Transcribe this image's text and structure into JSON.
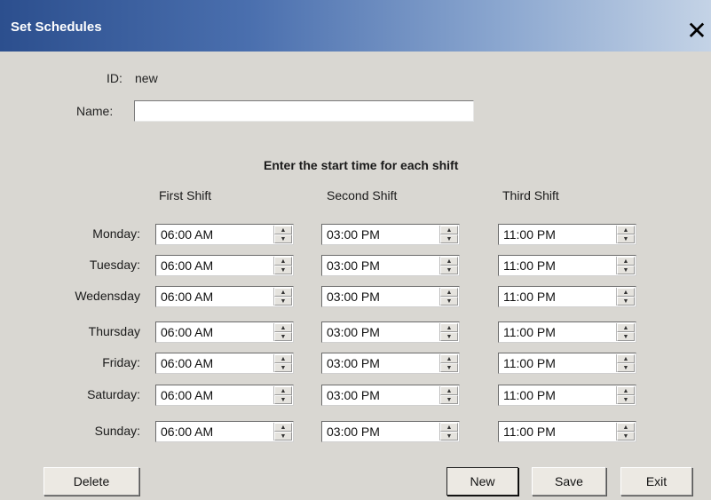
{
  "window": {
    "title": "Set Schedules",
    "close_label": "✕"
  },
  "form": {
    "id_label": "ID:",
    "id_value": "new",
    "name_label": "Name:",
    "name_value": "",
    "instruction": "Enter the start time for each shift"
  },
  "columns": [
    "First Shift",
    "Second Shift",
    "Third Shift"
  ],
  "rows": [
    {
      "day": "Monday:",
      "times": [
        "06:00 AM",
        "03:00 PM",
        "11:00 PM"
      ]
    },
    {
      "day": "Tuesday:",
      "times": [
        "06:00 AM",
        "03:00 PM",
        "11:00 PM"
      ]
    },
    {
      "day": "Wedensday",
      "times": [
        "06:00 AM",
        "03:00 PM",
        "11:00 PM"
      ]
    },
    {
      "day": "Thursday",
      "times": [
        "06:00 AM",
        "03:00 PM",
        "11:00 PM"
      ]
    },
    {
      "day": "Friday:",
      "times": [
        "06:00 AM",
        "03:00 PM",
        "11:00 PM"
      ]
    },
    {
      "day": "Saturday:",
      "times": [
        "06:00 AM",
        "03:00 PM",
        "11:00 PM"
      ]
    },
    {
      "day": "Sunday:",
      "times": [
        "06:00 AM",
        "03:00 PM",
        "11:00 PM"
      ]
    }
  ],
  "buttons": {
    "delete": "Delete",
    "new": "New",
    "save": "Save",
    "exit": "Exit"
  },
  "icons": {
    "close": "close-icon",
    "spin_up": "spin-up-icon",
    "spin_down": "spin-down-icon"
  },
  "colors": {
    "titlebar_start": "#2c4f8e",
    "titlebar_end": "#c4d3e6",
    "dialog_bg": "#d9d7d2"
  }
}
